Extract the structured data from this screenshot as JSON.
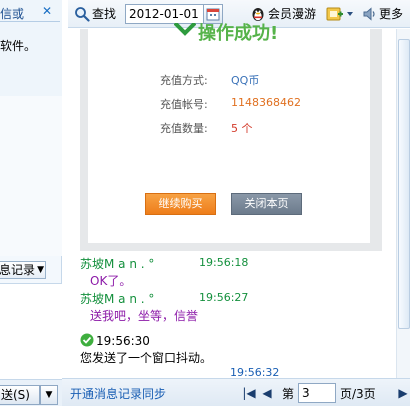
{
  "left_panel": {
    "title": "信或",
    "close": "✕",
    "body_text": "软件。",
    "record_select": "息记录",
    "send_label": "送(S)"
  },
  "toolbar": {
    "search_label": "查找",
    "date_value": "2012-01-01",
    "roam_label": "会员漫游",
    "more_label": "更多"
  },
  "card": {
    "banner_title": "操作成功!",
    "rows": [
      {
        "label": "充值方式:",
        "value": "QQ币",
        "color": "#3a72b8"
      },
      {
        "label": "充值帐号:",
        "value": "1148368462",
        "color": "#e07020"
      },
      {
        "label": "充值数量:",
        "value": "5 个",
        "color": "#d33a2a"
      }
    ],
    "buy_button": "继续购买",
    "close_button": "关闭本页"
  },
  "messages": [
    {
      "sender": "苏坡M a n  .    °",
      "time": "19:56:18",
      "text": "OK了。"
    },
    {
      "sender": "苏坡M a n  .    °",
      "time": "19:56:27",
      "text": "送我吧，坐等，信誉"
    }
  ],
  "system_message": {
    "time": "19:56:30",
    "text": "您发送了一个窗口抖动。"
  },
  "last_time": "19:56:32",
  "bottom_bar": {
    "sync_link": "开通消息记录同步",
    "page_prefix": "第",
    "page_value": "3",
    "page_suffix": "页/3页"
  },
  "colors": {
    "accent": "#1a5fb4",
    "sender": "#14903d",
    "message": "#8c1aa8",
    "success": "#56b34a"
  }
}
